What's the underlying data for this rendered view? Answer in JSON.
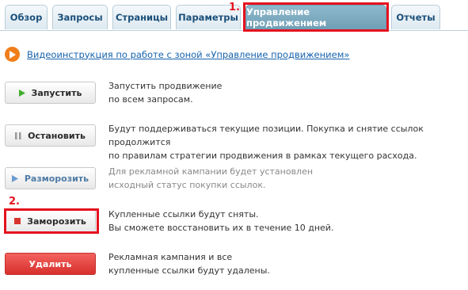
{
  "tabs": [
    {
      "label": "Обзор"
    },
    {
      "label": "Запросы"
    },
    {
      "label": "Страницы"
    },
    {
      "label": "Параметры"
    },
    {
      "label": "Управление продвижением"
    },
    {
      "label": "Отчеты"
    }
  ],
  "annotations": {
    "mark1": "1.",
    "mark2": "2."
  },
  "video": {
    "link_text": "Видеоинструкция по работе с зоной «Управление продвижением»",
    "icon": "play-icon"
  },
  "actions": [
    {
      "button": "Запустить",
      "icon": "play-triangle-icon",
      "desc_line1": "Запустить продвижение",
      "desc_line2": "по всем запросам."
    },
    {
      "button": "Остановить",
      "icon": "pause-icon",
      "desc_line1": "Будут поддерживаться текущие позиции. Покупка и снятие ссылок продолжится",
      "desc_line2": "по правилам стратегии продвижения в рамках текущего расхода."
    },
    {
      "button": "Разморозить",
      "icon": "play-triangle-icon",
      "desc_line1": "Для рекламной кампании будет установлен",
      "desc_line2": "исходный статус покупки ссылок."
    },
    {
      "button": "Заморозить",
      "icon": "stop-square-icon",
      "desc_line1": "Купленные ссылки будут сняты.",
      "desc_line2": "Вы сможете восстановить их в течение 10 дней."
    },
    {
      "button": "Удалить",
      "desc_line1": "Рекламная кампания и все",
      "desc_line2": "купленные ссылки будут удалены."
    }
  ],
  "colors": {
    "accent_red": "#e5121e",
    "active_tab": "#7aa8bd",
    "link": "#1763ad",
    "play_orange": "#f07e1b",
    "delete_red": "#d9342f"
  }
}
